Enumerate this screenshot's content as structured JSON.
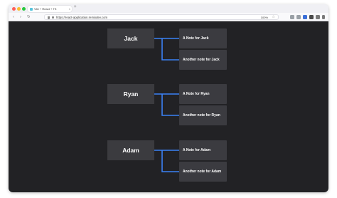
{
  "browser": {
    "tab_title": "Vite + React + TS",
    "tab_close": "×",
    "new_tab": "+",
    "url": "https://react-application.remixdev.com",
    "zoom": "100%",
    "back": "‹",
    "forward": "›",
    "reload": "↻",
    "star": "☆"
  },
  "tree": [
    {
      "name": "Jack",
      "notes": [
        "A Note for Jack",
        "Another note for Jack"
      ]
    },
    {
      "name": "Ryan",
      "notes": [
        "A Note for Ryan",
        "Another note for Ryan"
      ]
    },
    {
      "name": "Adam",
      "notes": [
        "A Note for Adam",
        "Another note for Adam"
      ]
    }
  ],
  "colors": {
    "canvas": "#222225",
    "card": "#3b3b3f",
    "connector": "#3b82f6"
  }
}
